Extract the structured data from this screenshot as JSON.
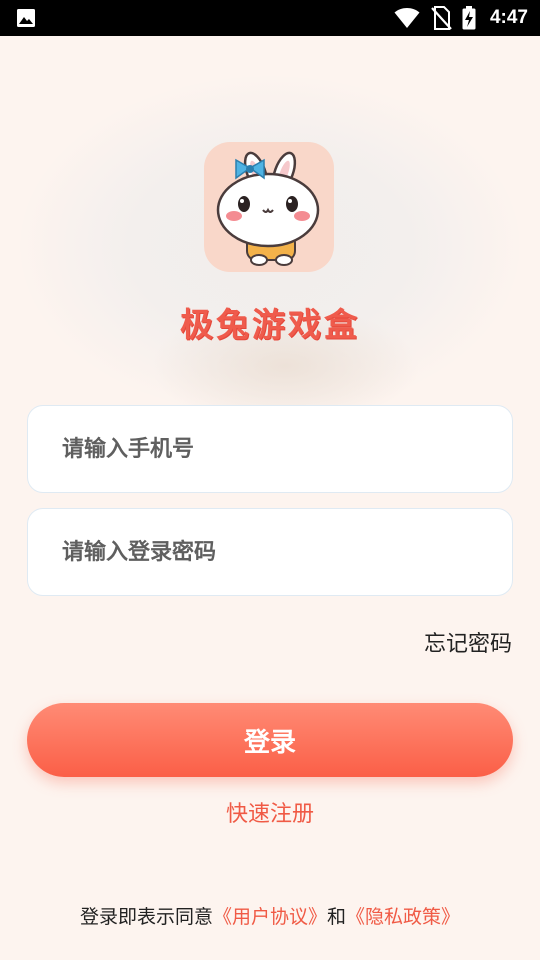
{
  "status_bar": {
    "time": "4:47",
    "icons": [
      "gallery-icon",
      "wifi-icon",
      "no-sim-icon",
      "battery-charging-icon"
    ]
  },
  "app": {
    "name": "极兔游戏盒",
    "logo_icon": "bunny-mascot-logo"
  },
  "form": {
    "phone_placeholder": "请输入手机号",
    "phone_value": "",
    "password_placeholder": "请输入登录密码",
    "password_value": ""
  },
  "forgot_password_label": "忘记密码",
  "login_button_label": "登录",
  "register_label": "快速注册",
  "agreement": {
    "prefix": "登录即表示同意",
    "user_agreement": "《用户协议》",
    "conjunction": "和",
    "privacy_policy": "《隐私政策》"
  },
  "colors": {
    "accent": "#f05a45",
    "button_top": "#ff8b75",
    "button_bottom": "#fb5f47",
    "background": "#fdf4ef"
  }
}
